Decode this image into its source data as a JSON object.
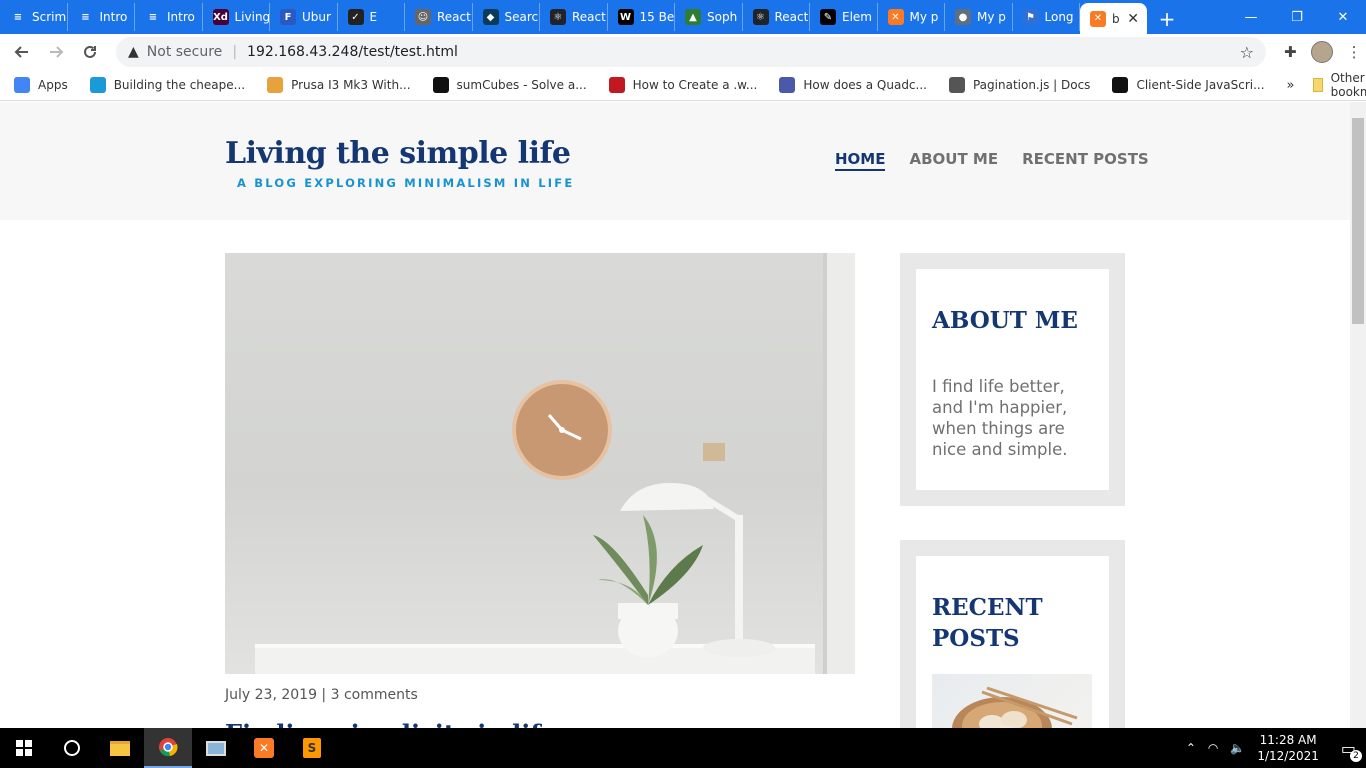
{
  "browser": {
    "tabs": [
      {
        "label": "Scrim",
        "icon": "scrimba-icon",
        "color": "#1a73e8",
        "glyph": "≡"
      },
      {
        "label": "Intro",
        "icon": "scrimba-icon",
        "color": "#1a73e8",
        "glyph": "≡"
      },
      {
        "label": "Intro",
        "icon": "scrimba-icon",
        "color": "#1a73e8",
        "glyph": "≡"
      },
      {
        "label": "Living",
        "icon": "adobe-xd-icon",
        "color": "#470137",
        "glyph": "Xd"
      },
      {
        "label": "Ubur",
        "icon": "f-icon",
        "color": "#2b59c3",
        "glyph": "F"
      },
      {
        "label": "E",
        "icon": "checkmark-icon",
        "color": "#222222",
        "glyph": "✓"
      },
      {
        "label": "React",
        "icon": "avatar-icon",
        "color": "#666666",
        "glyph": "☺"
      },
      {
        "label": "Search",
        "icon": "graphql-icon",
        "color": "#0b3b5c",
        "glyph": "◆"
      },
      {
        "label": "React",
        "icon": "react-icon",
        "color": "#20232a",
        "glyph": "⚛"
      },
      {
        "label": "15 Be",
        "icon": "wix-icon",
        "color": "#000000",
        "glyph": "W"
      },
      {
        "label": "Soph",
        "icon": "chart-icon",
        "color": "#2e7d32",
        "glyph": "▲"
      },
      {
        "label": "React",
        "icon": "react-icon",
        "color": "#20232a",
        "glyph": "⚛"
      },
      {
        "label": "Elem",
        "icon": "pen-icon",
        "color": "#000000",
        "glyph": "✎"
      },
      {
        "label": "My p",
        "icon": "xampp-icon",
        "color": "#fb7a24",
        "glyph": "✕"
      },
      {
        "label": "My p",
        "icon": "globe-icon",
        "color": "#5f6f80",
        "glyph": "●"
      },
      {
        "label": "Long",
        "icon": "flag-icon",
        "color": "#2f6fd6",
        "glyph": "⚑"
      }
    ],
    "active_tab": {
      "label": "b",
      "icon": "xampp-icon",
      "color": "#fb7a24",
      "glyph": "✕",
      "close": "✕"
    },
    "new_tab": "+",
    "window_controls": {
      "minimize": "—",
      "restore": "❐",
      "close": "✕"
    },
    "address": {
      "security": "Not secure",
      "url": "192.168.43.248/test/test.html"
    },
    "bookmarks": [
      {
        "label": "Apps",
        "icon": "apps-grid-icon",
        "color": "#4285f4"
      },
      {
        "label": "Building the cheape...",
        "icon": "diamond-icon",
        "color": "#1a9ad6"
      },
      {
        "label": "Prusa I3 Mk3 With...",
        "icon": "hardhat-icon",
        "color": "#e6a23c"
      },
      {
        "label": "sumCubes - Solve a...",
        "icon": "cube-icon",
        "color": "#111111"
      },
      {
        "label": "How to Create a .w...",
        "icon": "bird-icon",
        "color": "#c2181f"
      },
      {
        "label": "How does a Quadc...",
        "icon": "drone-icon",
        "color": "#4a5aa8"
      },
      {
        "label": "Pagination.js | Docs",
        "icon": "globe-icon",
        "color": "#555555"
      },
      {
        "label": "Client-Side JavaScri...",
        "icon": "code-icon",
        "color": "#111111"
      }
    ],
    "bookmarks_more": "»",
    "other_bookmarks": "Other bookmarks"
  },
  "site": {
    "title": "Living the simple life",
    "subtitle": "A BLOG EXPLORING MINIMALISM IN LIFE",
    "nav": [
      "HOME",
      "ABOUT ME",
      "RECENT POSTS"
    ],
    "post": {
      "meta": "July 23, 2019 | 3 comments",
      "title": "Finding simplicity in life"
    },
    "about": {
      "title": "ABOUT ME",
      "body": "I find life better, and I'm happier, when things are nice and simple."
    },
    "recent": {
      "title": "RECENT POSTS"
    }
  },
  "taskbar": {
    "time": "11:28 AM",
    "date": "1/12/2021",
    "notifications": "2"
  },
  "colors": {
    "brand": "#143774",
    "accent": "#1792d2",
    "chrome": "#1a73e8"
  }
}
